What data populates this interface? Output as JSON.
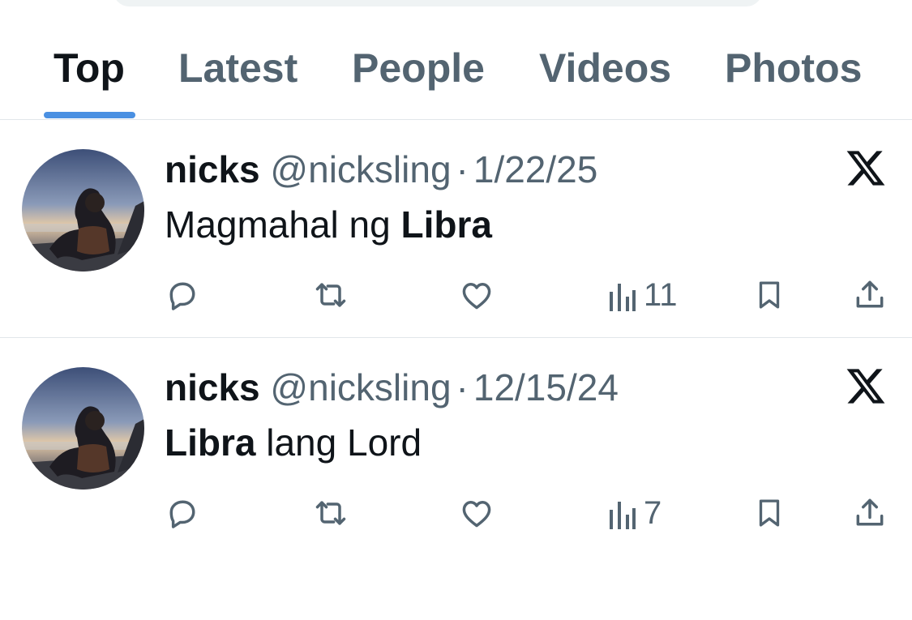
{
  "tabs": [
    {
      "label": "Top",
      "active": true
    },
    {
      "label": "Latest",
      "active": false
    },
    {
      "label": "People",
      "active": false
    },
    {
      "label": "Videos",
      "active": false
    },
    {
      "label": "Photos",
      "active": false
    }
  ],
  "colors": {
    "text_primary": "#0f1419",
    "text_secondary": "#536471",
    "tab_indicator": "#4a90e2",
    "divider": "#e1e6ea"
  },
  "tweets": [
    {
      "author_name": "nicks",
      "handle": "@nicksling",
      "separator": "·",
      "date": "1/22/25",
      "text_parts": [
        {
          "text": "Magmahal ng ",
          "bold": false
        },
        {
          "text": "Libra",
          "bold": true
        }
      ],
      "views": "11",
      "source_icon": "x-logo-icon"
    },
    {
      "author_name": "nicks",
      "handle": "@nicksling",
      "separator": "·",
      "date": "12/15/24",
      "text_parts": [
        {
          "text": "Libra",
          "bold": true
        },
        {
          "text": " lang Lord",
          "bold": false
        }
      ],
      "views": "7",
      "source_icon": "x-logo-icon"
    }
  ],
  "action_icons": [
    "reply-icon",
    "retweet-icon",
    "like-icon",
    "views-icon",
    "bookmark-icon",
    "share-icon"
  ]
}
